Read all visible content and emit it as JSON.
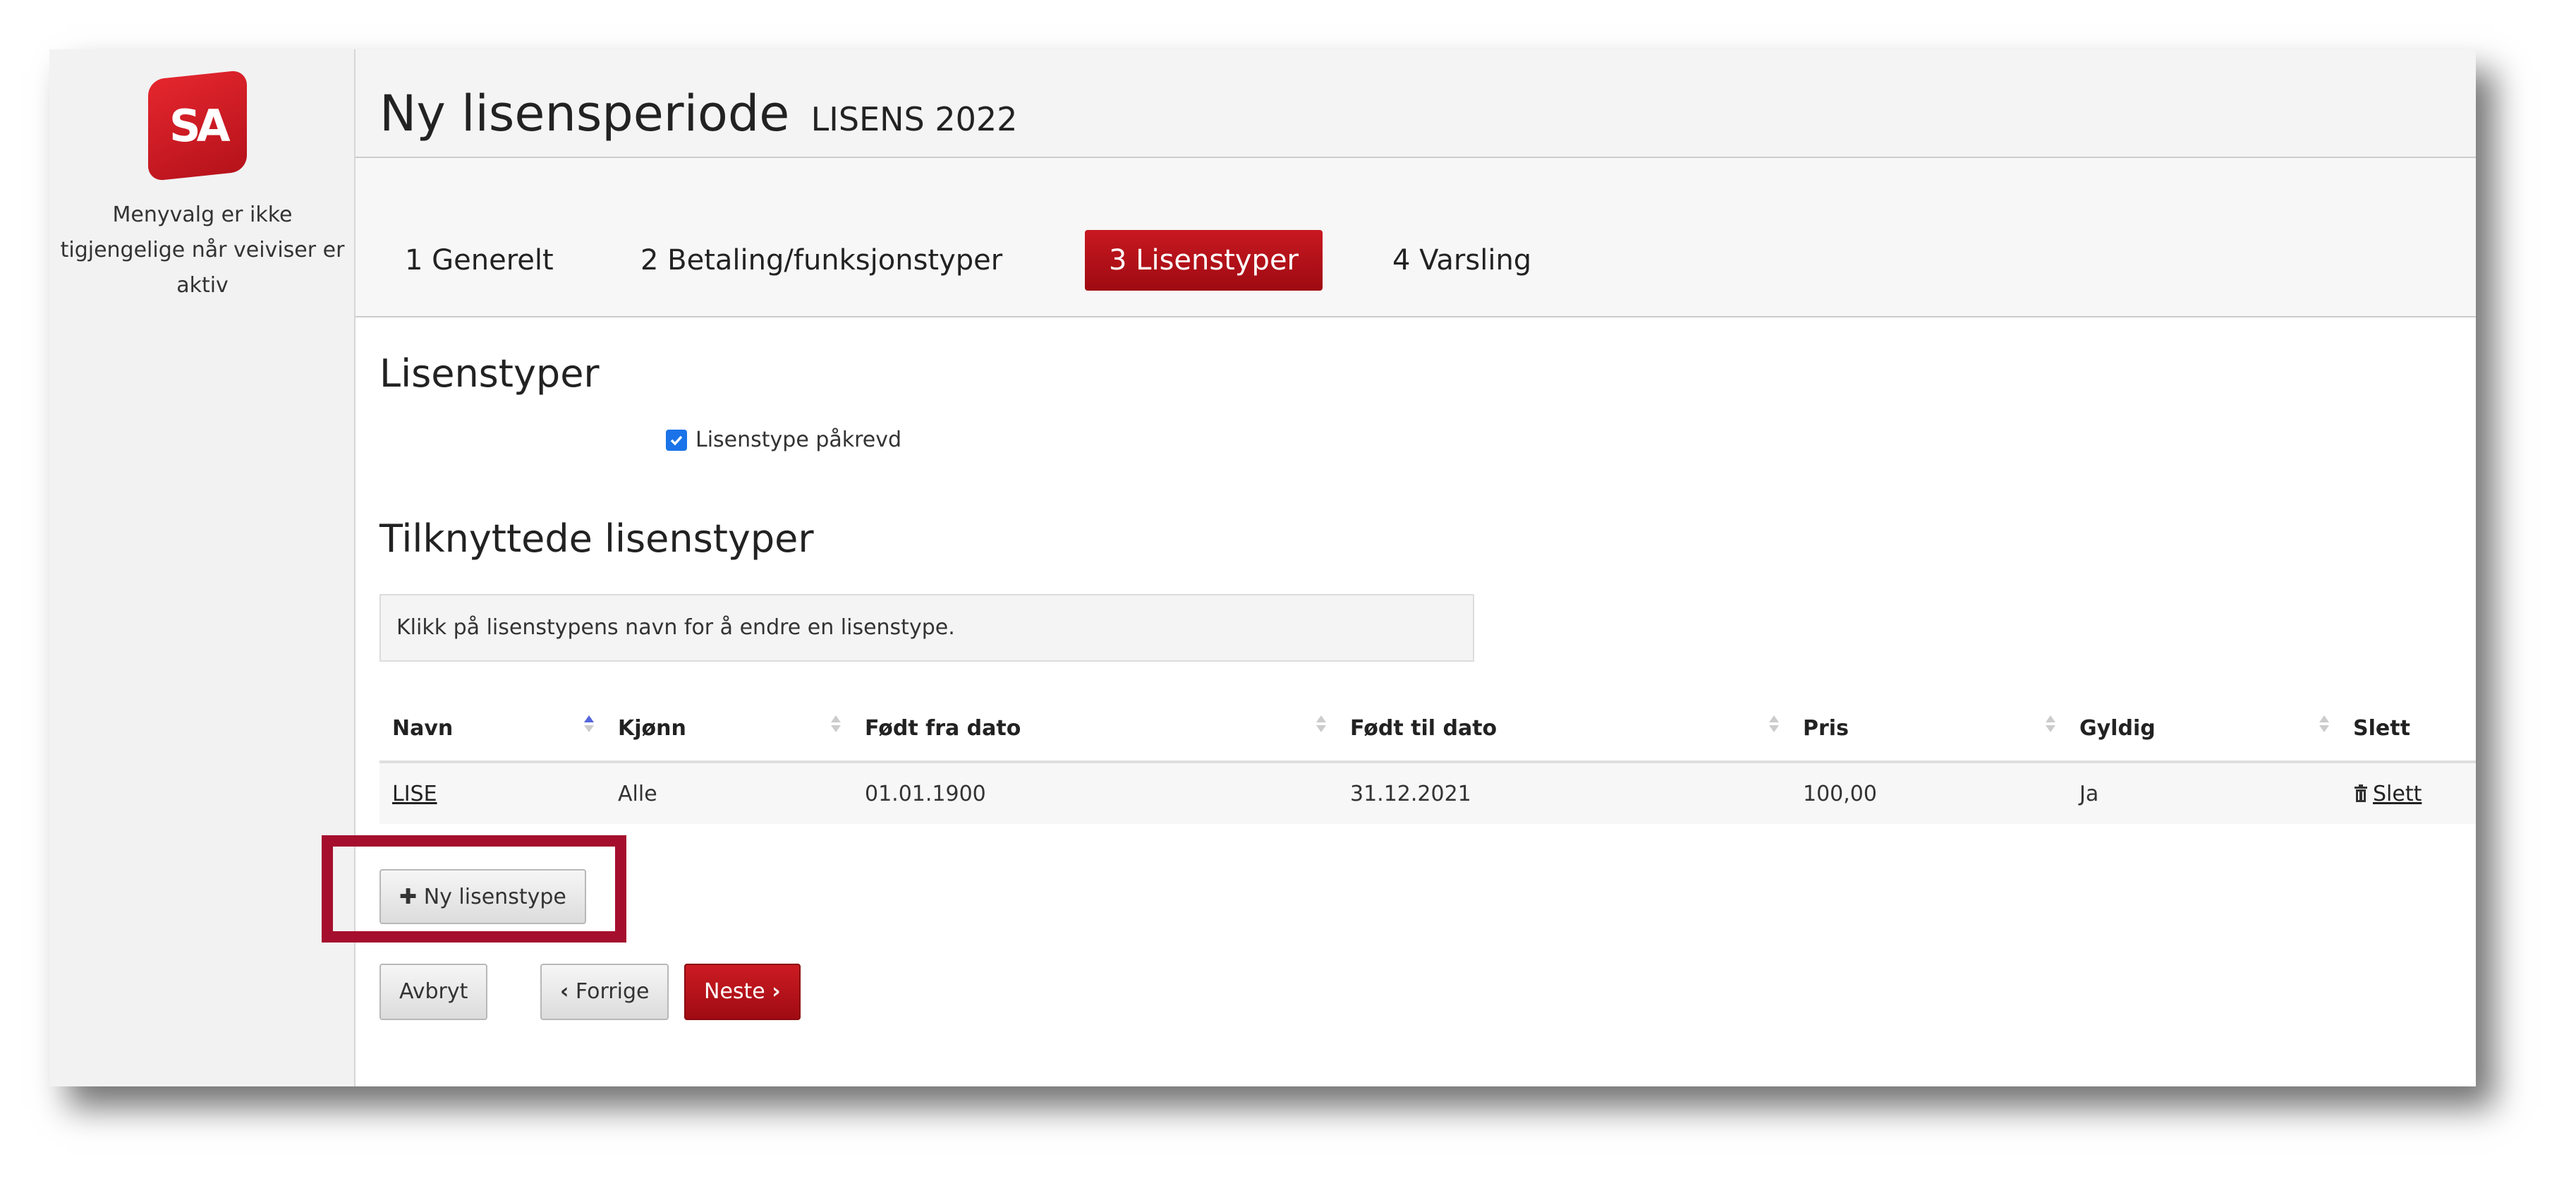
{
  "logo": {
    "text": "SA"
  },
  "sidebar": {
    "note": "Menyvalg er ikke tigjengelige når veiviser er aktiv"
  },
  "header": {
    "title": "Ny lisensperiode",
    "subtitle": "LISENS 2022"
  },
  "wizard": {
    "steps": [
      {
        "label": "1 Generelt",
        "active": false
      },
      {
        "label": "2 Betaling/funksjonstyper",
        "active": false
      },
      {
        "label": "3 Lisenstyper",
        "active": true
      },
      {
        "label": "4 Varsling",
        "active": false
      }
    ]
  },
  "section1": {
    "title": "Lisenstyper",
    "checkbox_label": "Lisenstype påkrevd",
    "checkbox_checked": true
  },
  "section2": {
    "title": "Tilknyttede lisenstyper",
    "info": "Klikk på lisenstypens navn for å endre en lisenstype."
  },
  "table": {
    "columns": [
      "Navn",
      "Kjønn",
      "Født fra dato",
      "Født til dato",
      "Pris",
      "Gyldig",
      "Slett"
    ],
    "rows": [
      {
        "navn": "LISE",
        "kjonn": "Alle",
        "fra": "01.01.1900",
        "til": "31.12.2021",
        "pris": "100,00",
        "gyldig": "Ja",
        "slett": "Slett"
      }
    ]
  },
  "buttons": {
    "new_type": "Ny lisenstype",
    "cancel": "Avbryt",
    "prev": "Forrige",
    "next": "Neste"
  },
  "colors": {
    "accent": "#b5121b",
    "highlight": "#a50f2d"
  }
}
